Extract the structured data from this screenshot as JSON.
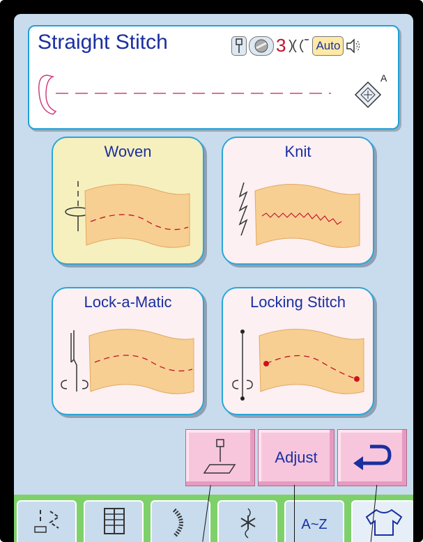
{
  "header": {
    "title": "Straight Stitch",
    "tension_value": "3",
    "auto_label": "Auto",
    "foot_label": "A"
  },
  "options": [
    {
      "label": "Woven"
    },
    {
      "label": "Knit"
    },
    {
      "label": "Lock-a-Matic"
    },
    {
      "label": "Locking Stitch"
    }
  ],
  "buttons": {
    "adjust_label": "Adjust"
  },
  "tabs": [
    {
      "icon": "straight-zigzag-icon"
    },
    {
      "icon": "buttonhole-icon"
    },
    {
      "icon": "satin-curve-icon"
    },
    {
      "icon": "decorative-stitch-icon"
    },
    {
      "label": "A~Z",
      "icon": "alphabet-icon"
    },
    {
      "icon": "garment-icon"
    }
  ],
  "colors": {
    "screen_bg": "#c8dcee",
    "accent_blue": "#1a2fa0",
    "selected_card": "#f6f0be",
    "button_pink": "#f7c6dd",
    "tab_green": "#7ed16a"
  }
}
